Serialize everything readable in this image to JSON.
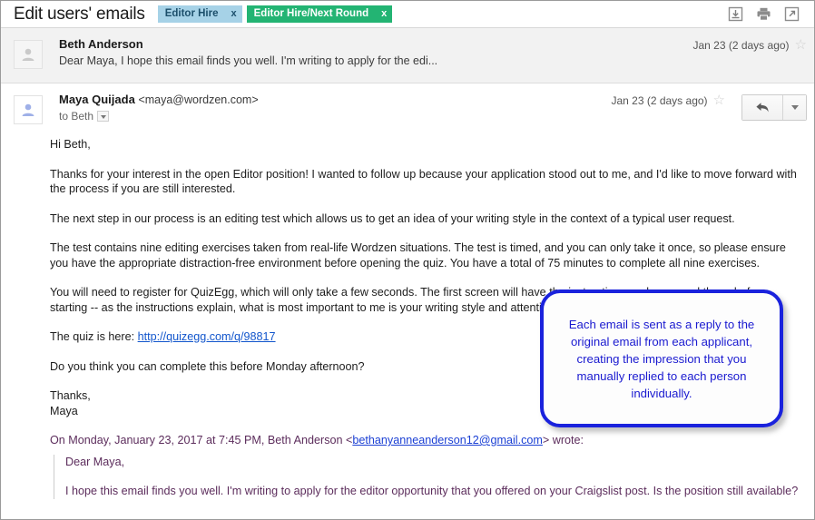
{
  "topbar": {
    "title": "Edit users' emails",
    "tags": [
      {
        "label": "Editor Hire",
        "close": "x",
        "style": "blue"
      },
      {
        "label": "Editor Hire/Next Round",
        "close": "x",
        "style": "green"
      }
    ],
    "icons": [
      "download-icon",
      "print-icon",
      "open-in-new-window-icon"
    ]
  },
  "messages": {
    "collapsed": {
      "sender": "Beth Anderson",
      "snippet": "Dear Maya, I hope this email finds you well. I'm writing to apply for the edi...",
      "date": "Jan 23 (2 days ago)",
      "star": "☆",
      "avatar": "person-icon"
    },
    "open": {
      "sender": "Maya Quijada",
      "sender_email": "<maya@wordzen.com>",
      "to": "to Beth",
      "date": "Jan 23 (2 days ago)",
      "star": "☆",
      "avatar": "person-icon",
      "reply_button": "reply-icon",
      "more_button": "chevron-down-icon"
    }
  },
  "body": {
    "greeting": "Hi Beth,",
    "paragraph1": "Thanks for your interest in the open Editor position! I wanted to follow up because your application stood out to me, and I'd like to move forward with the process if you are still interested.",
    "paragraph2": "The next step in our process is an editing test which allows us to get an idea of your writing style in the context of a typical user request.",
    "paragraph3": "The test contains nine editing exercises taken from real-life Wordzen situations. The test is timed, and you can only take it once, so please ensure you have the appropriate distraction-free environment before opening the quiz. You have a total of 75 minutes to complete all nine exercises.",
    "paragraph4": "You will need to register for QuizEgg, which will only take a few seconds. The first screen will have the instructions -- please read those before starting -- as the instructions explain, what is most important to me is your writing style and attention to detail.",
    "quiz_label": "The quiz is here: ",
    "quiz_link": "http://quizegg.com/q/98817",
    "paragraph5": "Do you think you can complete this before Monday afternoon?",
    "sign_off": "Thanks,",
    "sign_name": "Maya"
  },
  "quote": {
    "header_prefix": "On Monday, January 23, 2017 at 7:45 PM, Beth Anderson <",
    "header_email": "bethanyanneanderson12@gmail.com",
    "header_suffix": "> wrote:",
    "line1": "Dear Maya,",
    "line2": "I hope this email finds you well. I'm writing to apply for the editor opportunity that you offered on your Craigslist post. Is the position still available?"
  },
  "callout": {
    "text": "Each email is sent as a reply to the original email from each applicant, creating the impression that you manually replied to each person individually."
  },
  "colors": {
    "tag_blue_bg": "#a6d2e7",
    "tag_blue_text": "#1c4f6b",
    "tag_green_bg": "#23b473",
    "tag_green_text": "#ffffff",
    "callout_border": "#1a22dd",
    "callout_text": "#1a1ad0",
    "link": "#1155cc",
    "quote_text": "#5c2d5c"
  }
}
